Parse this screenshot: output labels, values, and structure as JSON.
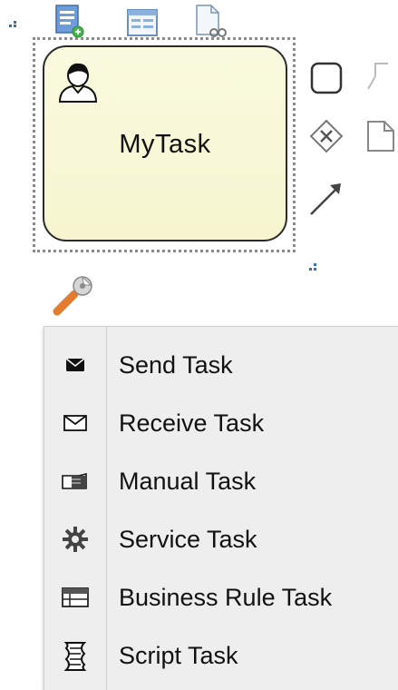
{
  "task": {
    "label": "MyTask",
    "type_icon": "user-task-icon"
  },
  "toolbar": {
    "top_icons": [
      "add-data-object-icon",
      "form-icon",
      "document-properties-icon"
    ],
    "palette_icons": [
      "task-icon",
      "text-annotation-icon",
      "exclusive-gateway-icon",
      "data-object-icon",
      "sequence-flow-icon"
    ],
    "change_type_icon": "wrench-icon"
  },
  "menu": {
    "items": [
      {
        "label": "Send Task",
        "icon": "send-envelope-icon"
      },
      {
        "label": "Receive Task",
        "icon": "receive-envelope-icon"
      },
      {
        "label": "Manual Task",
        "icon": "hand-icon"
      },
      {
        "label": "Service Task",
        "icon": "gear-icon"
      },
      {
        "label": "Business Rule Task",
        "icon": "table-icon"
      },
      {
        "label": "Script Task",
        "icon": "script-icon"
      }
    ]
  }
}
